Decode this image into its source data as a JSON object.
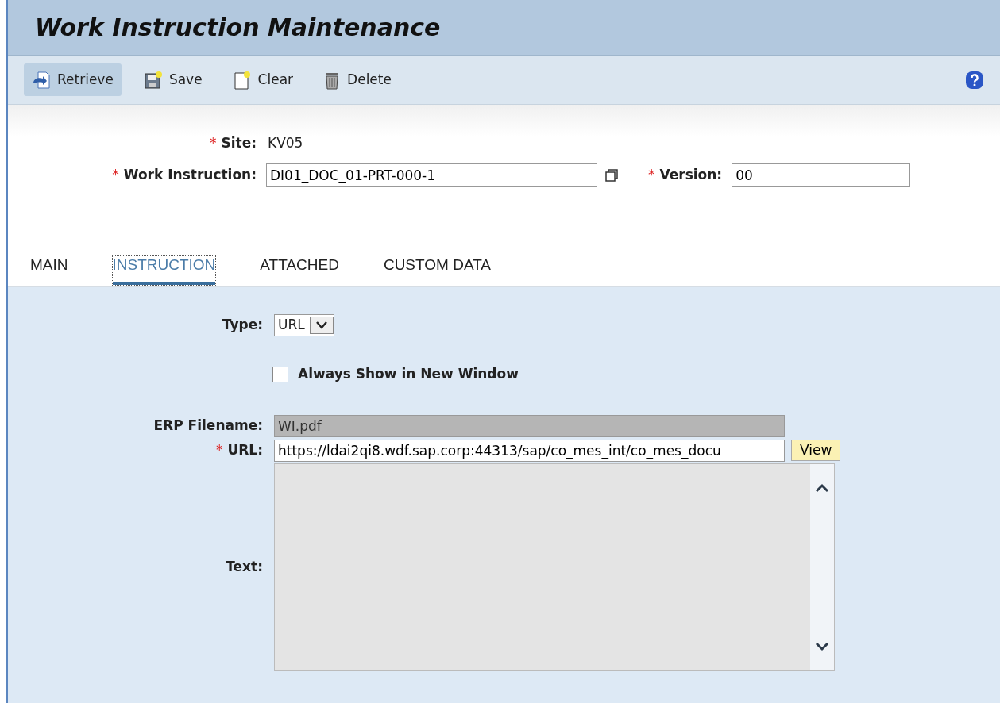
{
  "title": "Work Instruction Maintenance",
  "toolbar": [
    {
      "label": "Retrieve",
      "kind": "retrieve",
      "highlighted": true
    },
    {
      "label": "Save",
      "kind": "save",
      "highlighted": false
    },
    {
      "label": "Clear",
      "kind": "clear",
      "highlighted": false
    },
    {
      "label": "Delete",
      "kind": "delete",
      "highlighted": false
    }
  ],
  "site": {
    "marker": "*",
    "label": "Site:",
    "value": "KV05"
  },
  "work_instruction": {
    "marker": "*",
    "label": "Work Instruction:",
    "value": "DI01_DOC_01-PRT-000-1"
  },
  "version": {
    "marker": "*",
    "label": "Version:",
    "value": "00"
  },
  "tabs": [
    {
      "label": "MAIN",
      "selected": false
    },
    {
      "label": "INSTRUCTION",
      "selected": true
    },
    {
      "label": "ATTACHED",
      "selected": false
    },
    {
      "label": "CUSTOM DATA",
      "selected": false
    }
  ],
  "type": {
    "label": "Type:",
    "value": "URL"
  },
  "always_show": {
    "label": "Always Show in New Window",
    "checked": false
  },
  "erp_filename": {
    "label": "ERP Filename:",
    "value": "WI.pdf",
    "disabled": true
  },
  "url": {
    "marker": "*",
    "label": "URL:",
    "value": "https://ldai2qi8.wdf.sap.corp:44313/sap/co_mes_int/co_mes_docu",
    "button": "View"
  },
  "text": {
    "label": "Text:",
    "disabled": true
  }
}
